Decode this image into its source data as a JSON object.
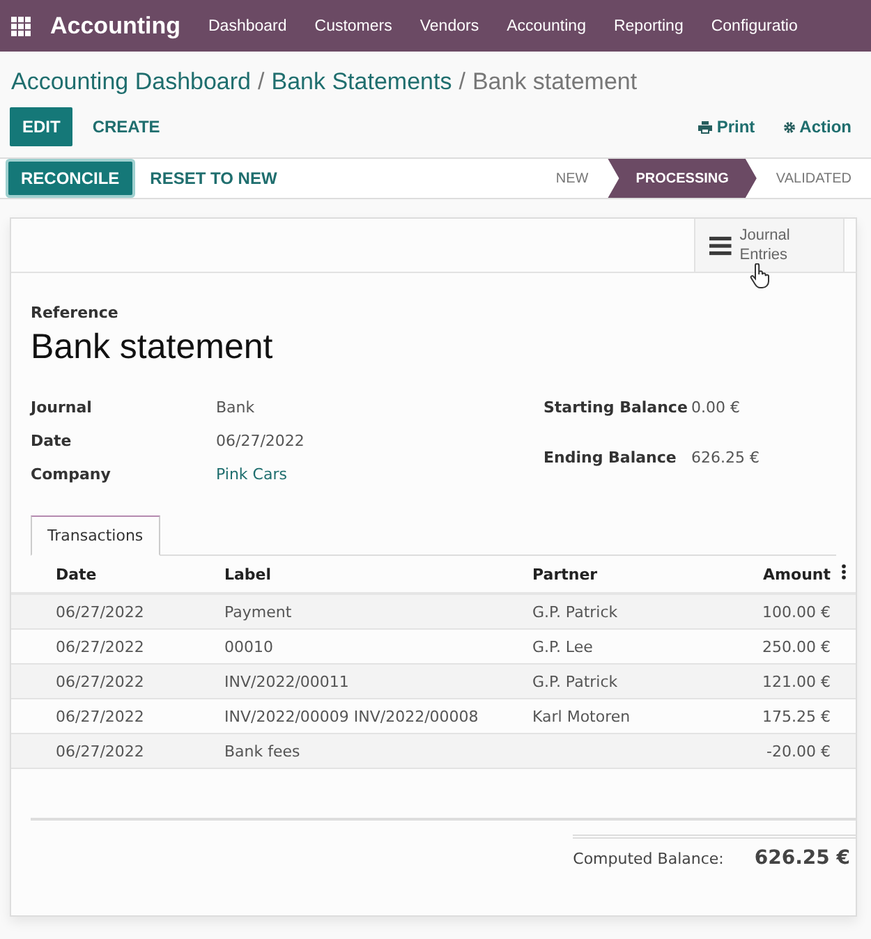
{
  "navbar": {
    "app_name": "Accounting",
    "menu": [
      "Dashboard",
      "Customers",
      "Vendors",
      "Accounting",
      "Reporting",
      "Configuratio"
    ]
  },
  "breadcrumb": [
    {
      "label": "Accounting Dashboard",
      "kind": "link"
    },
    {
      "label": "/",
      "kind": "separator"
    },
    {
      "label": "Bank Statements",
      "kind": "link"
    },
    {
      "label": "/",
      "kind": "separator"
    },
    {
      "label": "Bank statement",
      "kind": "current"
    }
  ],
  "actions": {
    "primary": "EDIT",
    "secondary": "CREATE",
    "print": "Print",
    "action": "Action"
  },
  "header_buttons": [
    {
      "label": "RECONCILE",
      "kind": "primary"
    },
    {
      "label": "RESET TO NEW",
      "kind": "link"
    }
  ],
  "stages": [
    {
      "label": "NEW",
      "selected": false
    },
    {
      "label": "PROCESSING",
      "selected": true
    },
    {
      "label": "VALIDATED",
      "selected": false
    }
  ],
  "smart_button": {
    "label": "Journal Entries"
  },
  "reference_label": "Reference",
  "title": "Bank statement",
  "left_fields": [
    {
      "label": "Journal",
      "value": "Bank",
      "link": false
    },
    {
      "label": "Date",
      "value": "06/27/2022",
      "link": false
    },
    {
      "label": "Company",
      "value": "Pink Cars",
      "link": true
    }
  ],
  "right_fields": [
    {
      "label": "Starting Balance",
      "value": "0.00 €"
    },
    {
      "label": "Ending Balance",
      "value": "626.25 €"
    }
  ],
  "tabs": [
    {
      "label": "Transactions",
      "selected": true
    }
  ],
  "table": {
    "columns": [
      "Date",
      "Label",
      "Partner",
      "Amount"
    ],
    "rows": [
      {
        "date": "06/27/2022",
        "label": "Payment",
        "partner": "G.P. Patrick",
        "amount": "100.00 €"
      },
      {
        "date": "06/27/2022",
        "label": "00010",
        "partner": "G.P. Lee",
        "amount": "250.00 €"
      },
      {
        "date": "06/27/2022",
        "label": "INV/2022/00011",
        "partner": "G.P. Patrick",
        "amount": "121.00 €"
      },
      {
        "date": "06/27/2022",
        "label": "INV/2022/00009 INV/2022/00008",
        "partner": "Karl Motoren",
        "amount": "175.25 €"
      },
      {
        "date": "06/27/2022",
        "label": "Bank fees",
        "partner": "",
        "amount": "-20.00 €"
      }
    ]
  },
  "computed_balance": {
    "label": "Computed Balance:",
    "value": "626.25 €"
  }
}
